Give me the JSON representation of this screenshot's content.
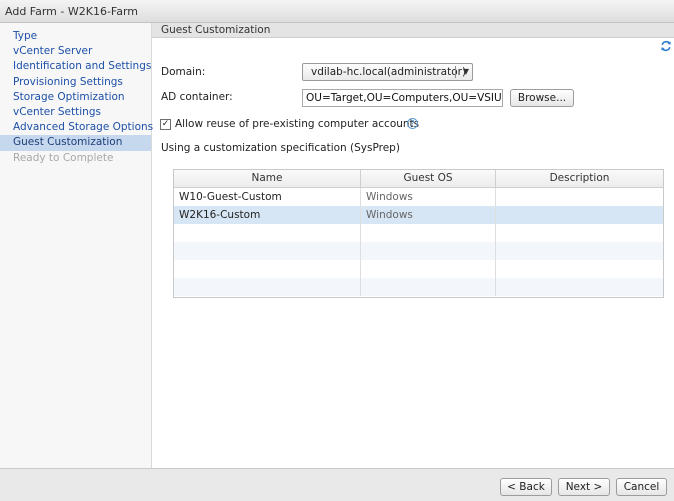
{
  "window": {
    "title": "Add Farm - W2K16-Farm"
  },
  "sidebar": {
    "items": [
      {
        "label": "Type"
      },
      {
        "label": "vCenter Server"
      },
      {
        "label": "Identification and Settings"
      },
      {
        "label": "Provisioning Settings"
      },
      {
        "label": "Storage Optimization"
      },
      {
        "label": "vCenter Settings"
      },
      {
        "label": "Advanced Storage Options"
      },
      {
        "label": "Guest Customization",
        "active": true
      },
      {
        "label": "Ready to Complete",
        "disabled": true
      }
    ]
  },
  "main": {
    "section_title": "Guest Customization",
    "domain": {
      "label": "Domain:",
      "value": "vdilab-hc.local(administrator)"
    },
    "ad_container": {
      "label": "AD container:",
      "value": "OU=Target,OU=Computers,OU=VSIUser",
      "browse_label": "Browse..."
    },
    "reuse_accounts": {
      "label": "Allow reuse of pre-existing computer accounts",
      "checked": true
    },
    "spec_heading": "Using a customization specification (SysPrep)",
    "table": {
      "columns": [
        "Name",
        "Guest OS",
        "Description"
      ],
      "rows": [
        {
          "name": "W10-Guest-Custom",
          "os": "Windows",
          "description": ""
        },
        {
          "name": "W2K16-Custom",
          "os": "Windows",
          "description": "",
          "selected": true
        }
      ]
    }
  },
  "footer": {
    "back_label": "< Back",
    "next_label": "Next >",
    "cancel_label": "Cancel"
  }
}
